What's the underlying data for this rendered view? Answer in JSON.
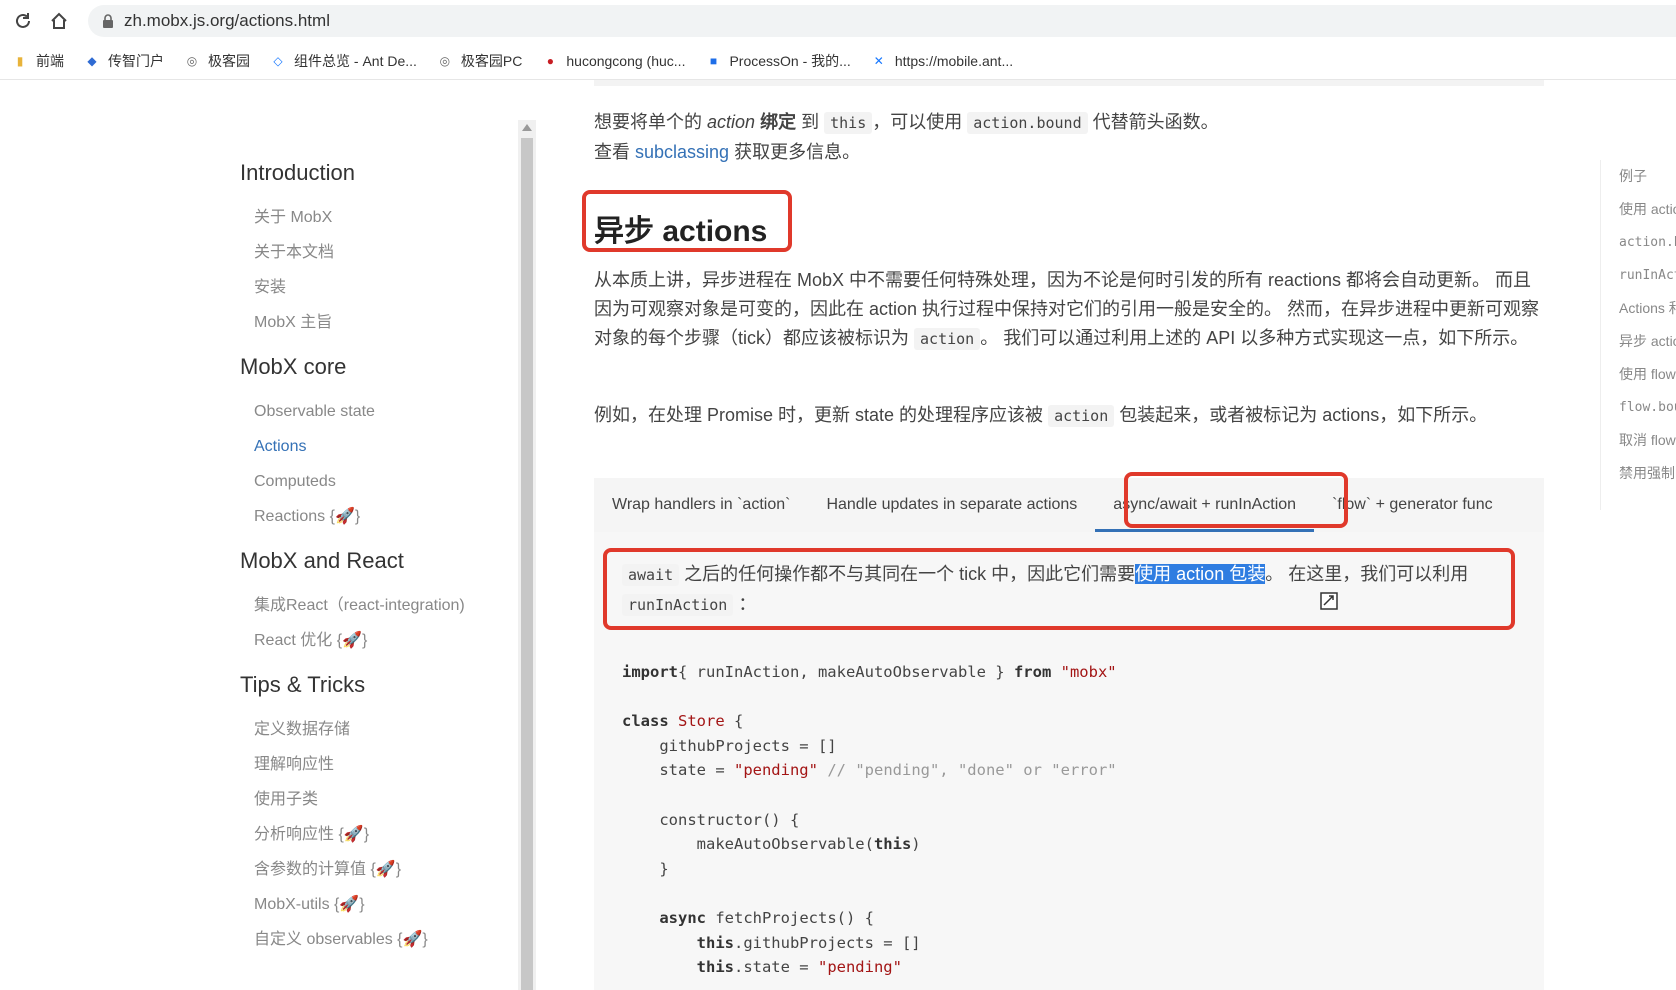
{
  "browser": {
    "url": "zh.mobx.js.org/actions.html",
    "bookmarks": [
      {
        "label": "前端",
        "icon": "folder-icon"
      },
      {
        "label": "传智门户",
        "icon": "edge-icon"
      },
      {
        "label": "极客园",
        "icon": "globe-icon"
      },
      {
        "label": "组件总览 - Ant De...",
        "icon": "antd-icon"
      },
      {
        "label": "极客园PC",
        "icon": "globe-icon"
      },
      {
        "label": "hucongcong (huc...",
        "icon": "gitee-icon"
      },
      {
        "label": "ProcessOn - 我的...",
        "icon": "processon-icon"
      },
      {
        "label": "https://mobile.ant...",
        "icon": "antd-mobile-icon"
      }
    ]
  },
  "sidebar": {
    "groups": [
      {
        "title": "Introduction",
        "items": [
          {
            "label": "关于 MobX"
          },
          {
            "label": "关于本文档"
          },
          {
            "label": "安装"
          },
          {
            "label": "MobX 主旨"
          }
        ]
      },
      {
        "title": "MobX core",
        "items": [
          {
            "label": "Observable state"
          },
          {
            "label": "Actions"
          },
          {
            "label": "Computeds"
          },
          {
            "label": "Reactions {🚀}"
          }
        ]
      },
      {
        "title": "MobX and React",
        "items": [
          {
            "label": "集成React（react-integration)"
          },
          {
            "label": "React 优化 {🚀}"
          }
        ]
      },
      {
        "title": "Tips & Tricks",
        "items": [
          {
            "label": "定义数据存储"
          },
          {
            "label": "理解响应性"
          },
          {
            "label": "使用子类"
          },
          {
            "label": "分析响应性 {🚀}"
          },
          {
            "label": "含参数的计算值 {🚀}"
          },
          {
            "label": "MobX-utils {🚀}"
          },
          {
            "label": "自定义 observables {🚀}"
          }
        ]
      }
    ]
  },
  "content": {
    "p1_a": "想要将单个的",
    "p1_em": "action",
    "p1_b": "绑定",
    "p1_c": "到",
    "p1_code1": "this",
    "p1_d": "，可以使用",
    "p1_code2": "action.bound",
    "p1_e": "代替箭头函数。",
    "p2_a": "查看",
    "p2_link": "subclassing",
    "p2_b": "获取更多信息。",
    "heading": "异步 actions",
    "p3_a": "从本质上讲，异步进程在 MobX 中不需要任何特殊处理，因为不论是何时引发的所有 reactions 都将会自动更新。 而且因为可观察对象是可变的，因此在 action 执行过程中保持对它们的引用一般是安全的。 然而，在异步进程中更新可观察对象的每个步骤（tick）都应该被标识为",
    "p3_code": "action",
    "p3_b": "。 我们可以通过利用上述的 API 以多种方式实现这一点，如下所示。",
    "p4_a": "例如，在处理 Promise 时，更新 state 的处理程序应该被",
    "p4_code": "action",
    "p4_b": "包装起来，或者被标记为 actions，如下所示。",
    "tabs": [
      "Wrap handlers in `action`",
      "Handle updates in separate actions",
      "async/await + runInAction",
      "`flow` + generator func"
    ],
    "active_tab": "async/await + runInAction",
    "note_code1": "await",
    "note_a": "之后的任何操作都不与其同在一个 tick 中，因此它们需要",
    "note_sel": "使用 action 包装",
    "note_b": "。 在这里，我们可以利用",
    "note_code2": "runInAction",
    "note_c": "："
  },
  "code_lines": [
    {
      "parts": [
        [
          "kw",
          "import"
        ],
        [
          "",
          "{ runInAction, makeAutoObservable } "
        ],
        [
          "kw",
          "from"
        ],
        [
          "",
          " "
        ],
        [
          "str",
          "\"mobx\""
        ]
      ]
    },
    {
      "parts": []
    },
    {
      "parts": [
        [
          "kw",
          "class"
        ],
        [
          "",
          " "
        ],
        [
          "cls",
          "Store"
        ],
        [
          "",
          " {"
        ]
      ]
    },
    {
      "parts": [
        [
          "",
          "    githubProjects = []"
        ]
      ]
    },
    {
      "parts": [
        [
          "",
          "    state = "
        ],
        [
          "str",
          "\"pending\""
        ],
        [
          "",
          " "
        ],
        [
          "cm",
          "// \"pending\", \"done\" or \"error\""
        ]
      ]
    },
    {
      "parts": []
    },
    {
      "parts": [
        [
          "",
          "    constructor() {"
        ]
      ]
    },
    {
      "parts": [
        [
          "",
          "        makeAutoObservable("
        ],
        [
          "kw",
          "this"
        ],
        [
          "",
          ")"
        ]
      ]
    },
    {
      "parts": [
        [
          "",
          "    }"
        ]
      ]
    },
    {
      "parts": []
    },
    {
      "parts": [
        [
          "",
          "    "
        ],
        [
          "kw",
          "async"
        ],
        [
          "",
          " fetchProjects() {"
        ]
      ]
    },
    {
      "parts": [
        [
          "",
          "        "
        ],
        [
          "kw",
          "this"
        ],
        [
          "",
          ".githubProjects = []"
        ]
      ]
    },
    {
      "parts": [
        [
          "",
          "        "
        ],
        [
          "kw",
          "this"
        ],
        [
          "",
          ".state = "
        ],
        [
          "str",
          "\"pending\""
        ]
      ]
    }
  ],
  "toc": [
    {
      "label": "例子",
      "code": false
    },
    {
      "label": "使用 action",
      "code": false
    },
    {
      "label": "action.bound",
      "code": true
    },
    {
      "label": "runInAction",
      "code": true
    },
    {
      "label": "Actions 和继承",
      "code": false
    },
    {
      "label": "异步 actions",
      "code": false
    },
    {
      "label": "使用 flow",
      "code": false
    },
    {
      "label": "flow.bound",
      "code": true
    },
    {
      "label": "取消 flow",
      "code": false
    },
    {
      "label": "禁用强制",
      "code": false
    }
  ]
}
